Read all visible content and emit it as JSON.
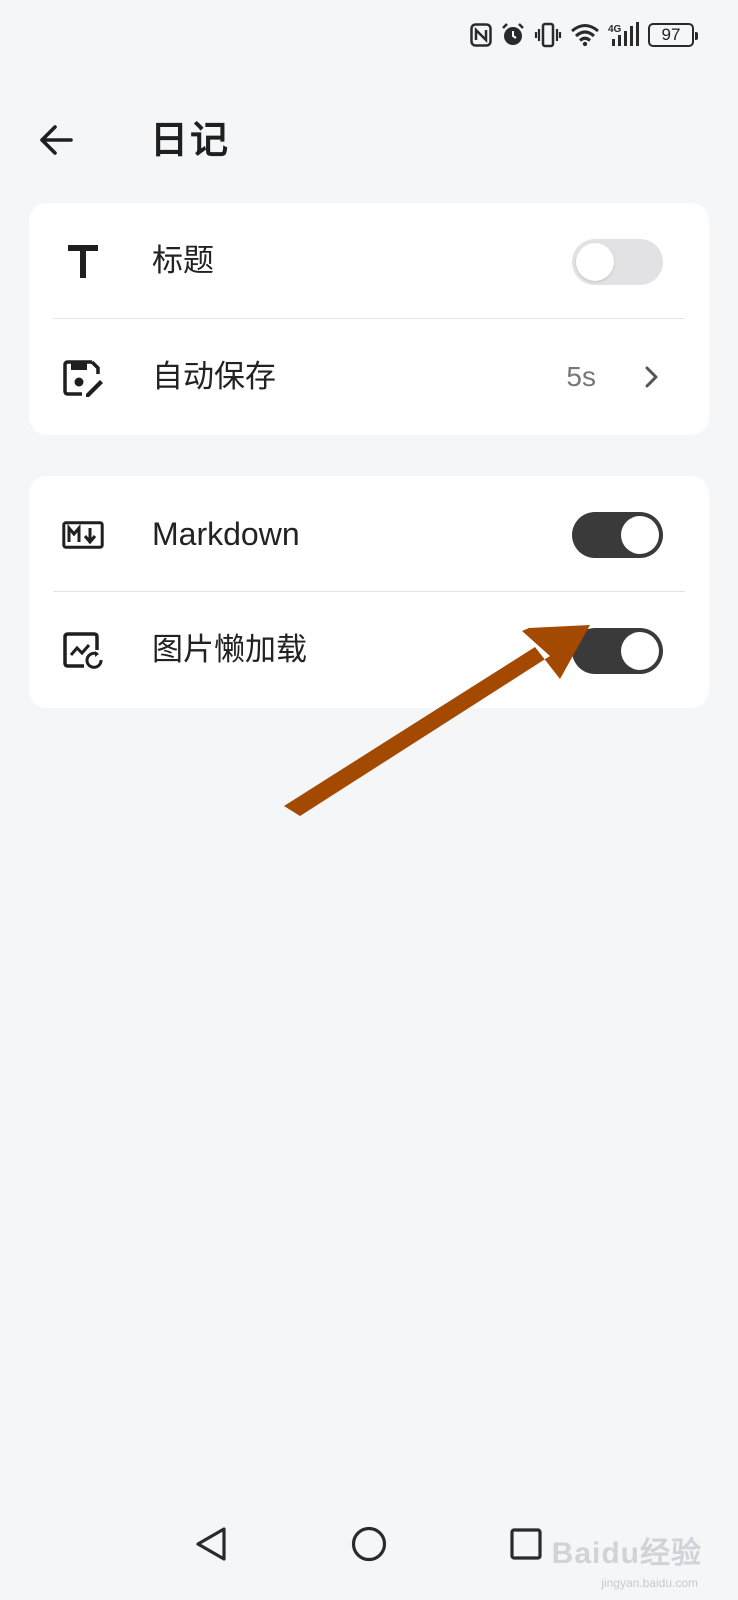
{
  "status_bar": {
    "battery_level": "97",
    "icons": [
      "nfc-icon",
      "alarm-icon",
      "vibrate-icon",
      "wifi-icon",
      "4g-signal-icon",
      "battery-icon"
    ],
    "signal_label": "4G"
  },
  "header": {
    "title": "日记",
    "back_icon": "arrow-left-icon"
  },
  "settings": {
    "group1": [
      {
        "icon": "title-t-icon",
        "label": "标题",
        "type": "toggle",
        "on": false
      },
      {
        "icon": "auto-save-icon",
        "label": "自动保存",
        "type": "link",
        "value": "5s"
      }
    ],
    "group2": [
      {
        "icon": "markdown-icon",
        "label": "Markdown",
        "type": "toggle",
        "on": true
      },
      {
        "icon": "image-lazy-load-icon",
        "label": "图片懒加载",
        "type": "toggle",
        "on": true
      }
    ]
  },
  "annotation": {
    "arrow_color": "#a34a00"
  },
  "navigation": {
    "icons": [
      "nav-back-icon",
      "nav-home-icon",
      "nav-recents-icon"
    ]
  },
  "watermark": {
    "text": "Baidu经验",
    "subtext": "jingyan.baidu.com"
  },
  "colors": {
    "background": "#f5f6f8",
    "card": "#ffffff",
    "toggle_on": "#3a3a3a",
    "toggle_off": "#e2e2e4"
  }
}
